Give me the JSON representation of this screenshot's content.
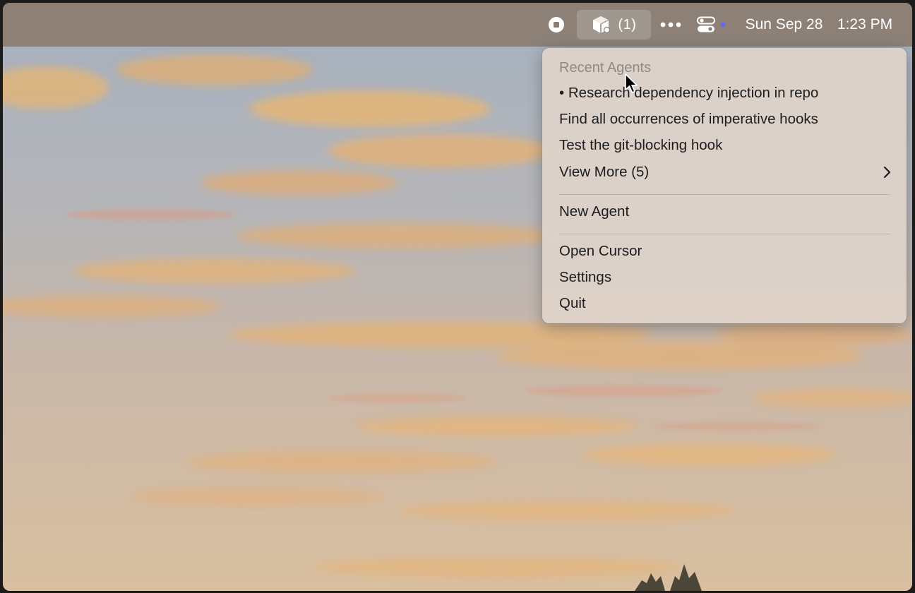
{
  "menubar": {
    "agents_count": "(1)",
    "date": "Sun Sep 28",
    "time": "1:23 PM",
    "icons": [
      "stop-icon",
      "agent-cube-icon",
      "more-dots-icon",
      "control-center-icon",
      "status-dot-icon"
    ]
  },
  "menu": {
    "header": "Recent Agents",
    "recent": [
      {
        "label": "• Research dependency injection in repo"
      },
      {
        "label": "Find all occurrences of imperative hooks"
      },
      {
        "label": "Test the git-blocking hook"
      }
    ],
    "view_more": "View More (5)",
    "new_agent": "New Agent",
    "open_cursor": "Open Cursor",
    "settings": "Settings",
    "quit": "Quit"
  },
  "colors": {
    "menubar_bg": "#8a7c71",
    "menu_bg": "#ded2ca",
    "status_dot": "#6a67f0",
    "header_text": "#8f8985"
  }
}
